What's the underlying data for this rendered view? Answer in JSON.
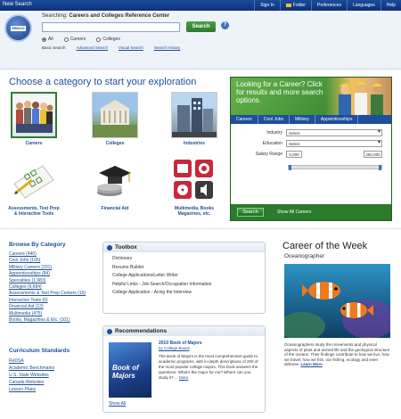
{
  "topbar": {
    "new_search": "New Search",
    "nav": [
      "Sign In",
      "Folder",
      "Preferences",
      "Languages",
      "Help"
    ]
  },
  "search": {
    "logo_text": "EBSCO",
    "searching_prefix": "Searching:",
    "database": "Careers and Colleges Reference Center",
    "input_value": "",
    "button": "Search",
    "help": "?",
    "radios": [
      "All",
      "Careers",
      "Colleges"
    ],
    "links": [
      "Basic Search",
      "Advanced Search",
      "Visual Search",
      "Search History"
    ]
  },
  "main": {
    "heading": "Choose a category to start your exploration",
    "categories": [
      {
        "label": "Careers"
      },
      {
        "label": "Colleges"
      },
      {
        "label": "Industries"
      },
      {
        "label": "Assessments, Test Prep & Interactive Tools"
      },
      {
        "label": "Financial Aid"
      },
      {
        "label": "Multimedia, Books Magazines, etc."
      }
    ]
  },
  "career_panel": {
    "banner": "Looking for a Career? Click for results and more search options.",
    "tabs": [
      "Careers",
      "Cool Jobs",
      "Military",
      "Apprenticeships"
    ],
    "industry_label": "Industry",
    "industry_value": "Select",
    "education_label": "Education",
    "education_value": "Select",
    "salary_label": "Salary Range",
    "salary_min": "5,000",
    "salary_max": "250,000",
    "search_button": "Search",
    "show_all": "Show All Careers"
  },
  "browse": {
    "title": "Browse By Category",
    "items": [
      "Careers (440)",
      "Cool Jobs (105)",
      "Military Careers (201)",
      "Apprenticeships (84)",
      "Specialties (1,983)",
      "Colleges (9,684)",
      "Assessments & Test Prep Centers (16)",
      "Interactive Tools (6)",
      "Financial Aid (13)",
      "Multimedia (475)",
      "Books, Magazines & Etc. (101)"
    ]
  },
  "standards": {
    "title": "Curriculum Standards",
    "items": [
      "ReDSA",
      "Academic Benchmarks",
      "U.S. State Websites",
      "Canada Websites",
      "Lesson Plans"
    ]
  },
  "toolbox": {
    "title": "Toolbox",
    "items": [
      "Dictionary",
      "Resume Builder",
      "College Applications/Letter Writer",
      "Helpful Links - Job Search/Occupation Information",
      "College Application - Acing the Interview"
    ]
  },
  "recommendations": {
    "title": "Recommendations",
    "cover_text": "Book of Majors",
    "book_title": "2010 Book of Majors",
    "book_author": "by College Board",
    "blurb": "The Book of Majors is the most comprehensive guide to academic programs, with in-depth descriptions of 200 of the most popular college majors. This book answers the questions: What's the major for me? Where can you study it? ...",
    "more": "More",
    "show_all": "Show All"
  },
  "cotw": {
    "title": "Career of the Week",
    "subtitle": "Oceanographer",
    "description": "Oceanographers study the movements and physical aspects of plant and animal life and the geological structure of the oceans. Their findings contribute to how we live, how we travel, how we fish, our fishing, ecology and even defense.",
    "learn_more": "Learn More"
  }
}
